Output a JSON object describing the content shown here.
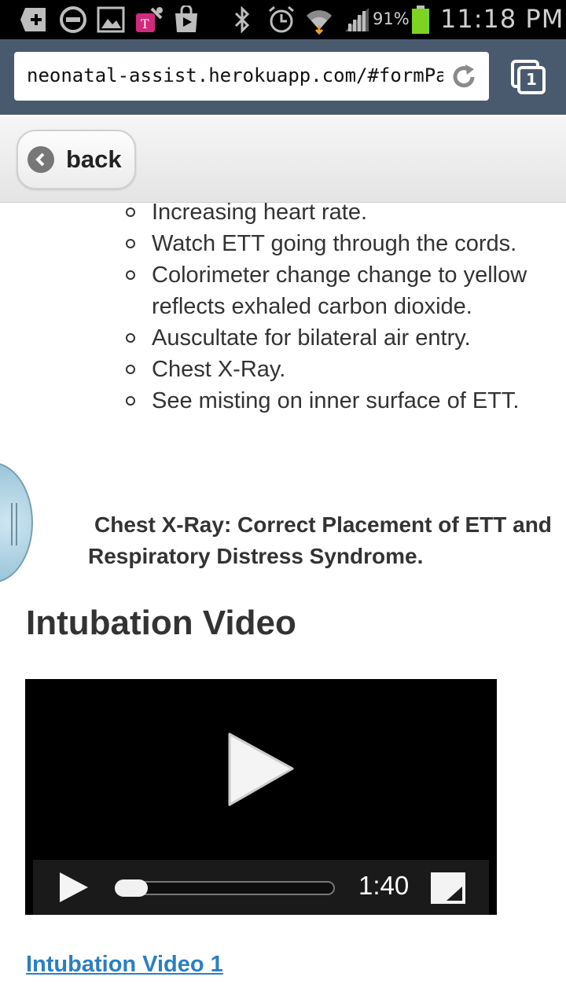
{
  "status_bar": {
    "battery": "91%",
    "time": "11:18 PM",
    "icons": [
      "add-icon",
      "minus-icon",
      "image-icon",
      "tmobile-icon",
      "play-store-icon",
      "bluetooth-icon",
      "alarm-icon",
      "wifi-icon",
      "signal-icon",
      "battery-icon"
    ]
  },
  "browser": {
    "url": "neonatal-assist.herokuapp.com/#formPa",
    "tab_count": "1",
    "colors": {
      "toolbar": "#4a5a6e"
    }
  },
  "header": {
    "back_label": "back"
  },
  "content": {
    "steps": [
      "Increasing heart rate.",
      "Watch ETT going through the cords.",
      "Colorimeter change change to yellow reflects exhaled carbon dioxide.",
      "Auscultate for bilateral air entry.",
      "Chest X-Ray.",
      "See misting on inner surface of ETT."
    ],
    "chest_xray_caption": "Chest X-Ray: Correct Placement of ETT and Respiratory Distress Syndrome.",
    "section_title": "Intubation Video",
    "video": {
      "duration": "1:40",
      "progress": 0.0
    },
    "link_label": "Intubation Video 1",
    "colors": {
      "link": "#2a7fc1"
    }
  }
}
